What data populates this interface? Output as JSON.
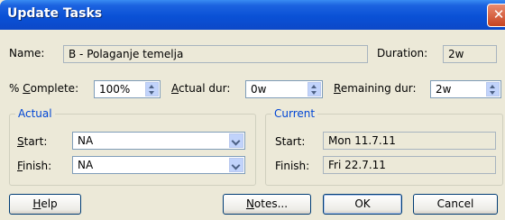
{
  "window": {
    "title": "Update Tasks",
    "close_symbol": "✕"
  },
  "name": {
    "label": "Name:",
    "value": "B - Polaganje temelja"
  },
  "duration": {
    "label": "Duration:",
    "value": "2w"
  },
  "complete": {
    "label_pre": "% ",
    "label_u": "C",
    "label_post": "omplete:",
    "value": "100%"
  },
  "actual_dur": {
    "label_pre": "",
    "label_u": "A",
    "label_post": "ctual dur:",
    "value": "0w"
  },
  "remaining_dur": {
    "label_pre": "",
    "label_u": "R",
    "label_post": "emaining dur:",
    "value": "2w"
  },
  "actual": {
    "title": "Actual",
    "start": {
      "label_u": "S",
      "label_post": "tart:",
      "value": "NA"
    },
    "finish": {
      "label_u": "F",
      "label_post": "inish:",
      "value": "NA"
    }
  },
  "current": {
    "title": "Current",
    "start": {
      "label": "Start:",
      "value": "Mon 11.7.11"
    },
    "finish": {
      "label": "Finish:",
      "value": "Fri 22.7.11"
    }
  },
  "buttons": {
    "help": {
      "u": "H",
      "rest": "elp"
    },
    "notes": {
      "u": "N",
      "rest": "otes..."
    },
    "ok": "OK",
    "cancel": "Cancel"
  }
}
